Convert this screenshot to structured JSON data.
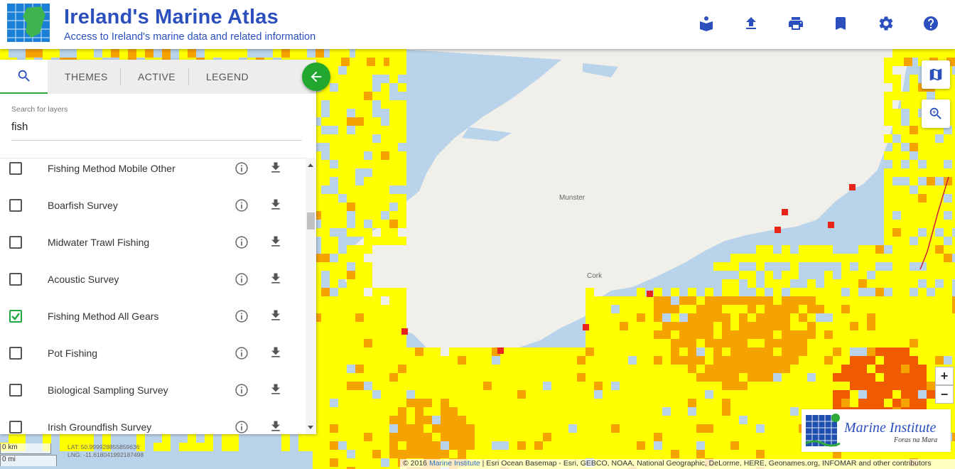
{
  "header": {
    "title": "Ireland's Marine Atlas",
    "subtitle": "Access to Ireland's marine data and related information",
    "buttons": [
      {
        "name": "book-reader-icon"
      },
      {
        "name": "upload-icon"
      },
      {
        "name": "print-icon"
      },
      {
        "name": "bookmark-icon"
      },
      {
        "name": "gear-icon"
      },
      {
        "name": "help-icon"
      }
    ]
  },
  "panel": {
    "tabs": {
      "themes": "THEMES",
      "active": "ACTIVE",
      "legend": "LEGEND"
    },
    "search": {
      "label": "Search for layers",
      "value": "fish"
    },
    "layers": [
      {
        "label": "Fishing Method Mobile Other",
        "checked": false
      },
      {
        "label": "Boarfish Survey",
        "checked": false
      },
      {
        "label": "Midwater Trawl Fishing",
        "checked": false
      },
      {
        "label": "Acoustic Survey",
        "checked": false
      },
      {
        "label": "Fishing Method All Gears",
        "checked": true
      },
      {
        "label": "Pot Fishing",
        "checked": false
      },
      {
        "label": "Biological Sampling Survey",
        "checked": false
      },
      {
        "label": "Irish Groundfish Survey",
        "checked": false
      }
    ]
  },
  "map": {
    "place_labels": {
      "munster": "Munster",
      "cork": "Cork"
    },
    "scale": {
      "km": "0 km",
      "mi": "0 mi"
    },
    "coords": {
      "lat": "LAT: 50.999928855859636",
      "lng": "LNG: -11.618041992187498"
    },
    "zoom_in": "+",
    "zoom_out": "−",
    "attribution_prefix": "© 2016",
    "attribution_link": "Marine Institute",
    "attribution_rest": "| Esri Ocean Basemap - Esri, GEBCO, NOAA, National Geographic, DeLorme, HERE, Geonames.org, INFOMAR and other contributors",
    "logo": {
      "name": "Marine Institute",
      "sub": "Foras na Mara"
    },
    "colors": {
      "low": "#ffff00",
      "mid": "#f6a300",
      "high": "#f05a00",
      "max": "#e8251a",
      "sea": "#b9d3ea",
      "land": "#f1efea"
    }
  }
}
